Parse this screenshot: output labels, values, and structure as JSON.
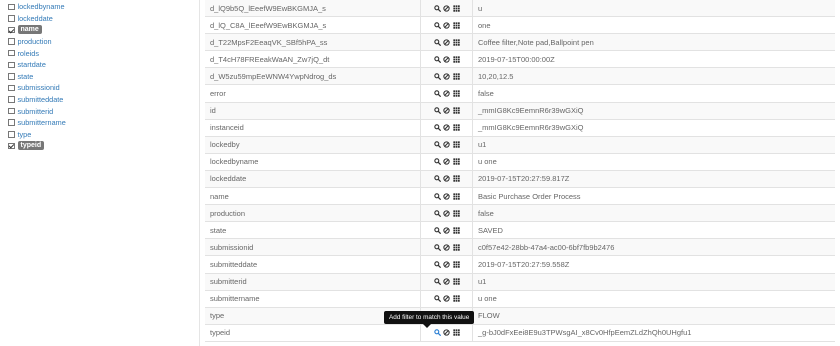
{
  "sidebar": {
    "fields": [
      {
        "label": "lockedbyname",
        "checked": false
      },
      {
        "label": "lockeddate",
        "checked": false
      },
      {
        "label": "name",
        "checked": true
      },
      {
        "label": "production",
        "checked": false
      },
      {
        "label": "roleids",
        "checked": false
      },
      {
        "label": "startdate",
        "checked": false
      },
      {
        "label": "state",
        "checked": false
      },
      {
        "label": "submissionid",
        "checked": false
      },
      {
        "label": "submitteddate",
        "checked": false
      },
      {
        "label": "submitterid",
        "checked": false
      },
      {
        "label": "submittername",
        "checked": false
      },
      {
        "label": "type",
        "checked": false
      },
      {
        "label": "typeid",
        "checked": true
      }
    ]
  },
  "table": {
    "rows": [
      {
        "key": "d_lQ9b5Q_lEeefW9EwBKGMJA_s",
        "value": "u"
      },
      {
        "key": "d_lQ_C8A_lEeefW9EwBKGMJA_s",
        "value": "one"
      },
      {
        "key": "d_T22MpsF2EeaqVK_SBf5hPA_ss",
        "value": "Coffee filter,Note pad,Ballpoint pen"
      },
      {
        "key": "d_T4cH78FREeakWaAN_Zw7jQ_dt",
        "value": "2019-07-15T00:00:00Z"
      },
      {
        "key": "d_W5zu59mpEeWNW4YwpNdrog_ds",
        "value": "10,20,12.5"
      },
      {
        "key": "error",
        "value": "false"
      },
      {
        "key": "id",
        "value": "_mmIG8Kc9EemnR6r39wGXiQ"
      },
      {
        "key": "instanceid",
        "value": "_mmIG8Kc9EemnR6r39wGXiQ"
      },
      {
        "key": "lockedby",
        "value": "u1"
      },
      {
        "key": "lockedbyname",
        "value": "u one"
      },
      {
        "key": "lockeddate",
        "value": "2019-07-15T20:27:59.817Z"
      },
      {
        "key": "name",
        "value": "Basic Purchase Order Process"
      },
      {
        "key": "production",
        "value": "false"
      },
      {
        "key": "state",
        "value": "SAVED"
      },
      {
        "key": "submissionid",
        "value": "c0f57e42-28bb-47a4-ac00-6bf7fb9b2476"
      },
      {
        "key": "submitteddate",
        "value": "2019-07-15T20:27:59.558Z"
      },
      {
        "key": "submitterid",
        "value": "u1"
      },
      {
        "key": "submittername",
        "value": "u one"
      },
      {
        "key": "type",
        "value": "FLOW"
      },
      {
        "key": "typeid",
        "value": "_g-bJ0dFxEei8E9u3TPWsgAI_x8Cv0HfpEemZLdZhQh0UHgfu1"
      }
    ]
  },
  "tooltip": {
    "text": "Add filter to match this value"
  },
  "icons": {
    "filter": "search-icon",
    "exclude": "ban-icon",
    "toggle_column": "columns-icon"
  },
  "colors": {
    "link": "#337ab7",
    "active_icon": "#2a7fd4",
    "pill": "#777777",
    "tooltip_bg": "#111111"
  }
}
